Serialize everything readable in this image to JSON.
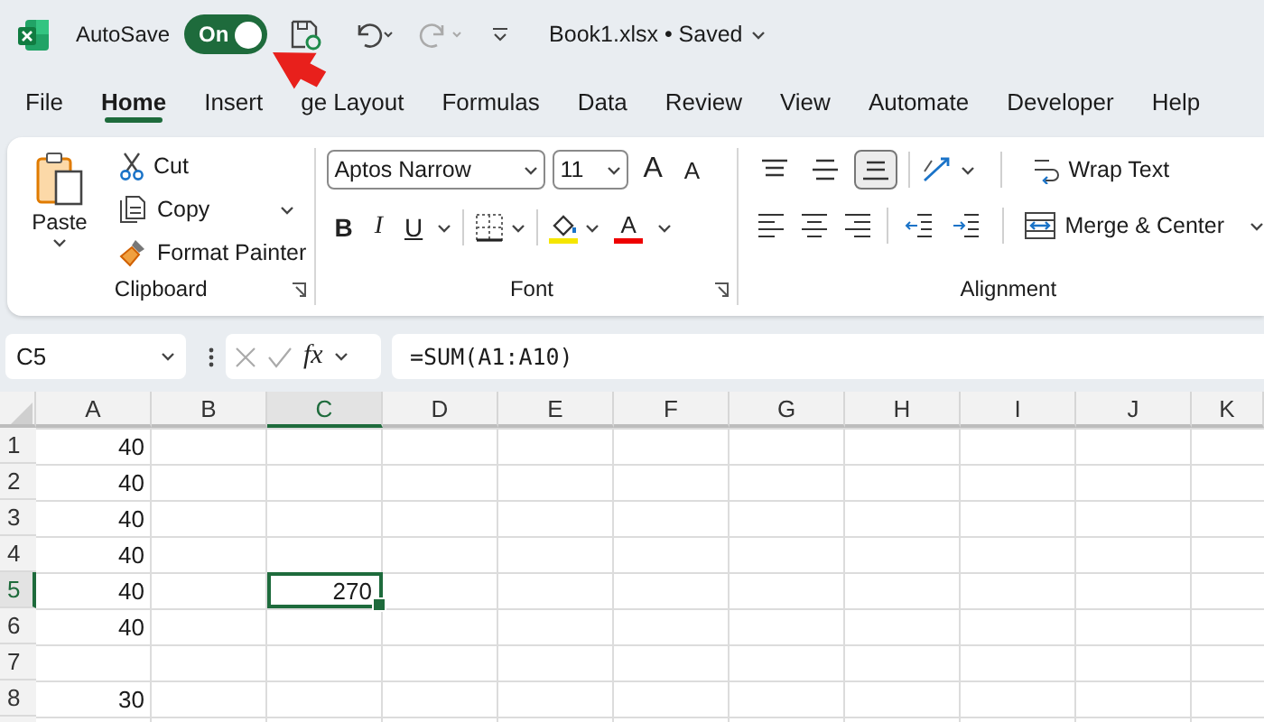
{
  "title_bar": {
    "autosave_label": "AutoSave",
    "autosave_toggle": {
      "label": "On",
      "on": true
    },
    "document_title": "Book1.xlsx • Saved"
  },
  "ribbon_tabs": [
    {
      "label": "File",
      "selected": false
    },
    {
      "label": "Home",
      "selected": true
    },
    {
      "label": "Insert",
      "selected": false
    },
    {
      "label": "ge Layout",
      "selected": false
    },
    {
      "label": "Formulas",
      "selected": false
    },
    {
      "label": "Data",
      "selected": false
    },
    {
      "label": "Review",
      "selected": false
    },
    {
      "label": "View",
      "selected": false
    },
    {
      "label": "Automate",
      "selected": false
    },
    {
      "label": "Developer",
      "selected": false
    },
    {
      "label": "Help",
      "selected": false
    }
  ],
  "clipboard": {
    "paste": "Paste",
    "cut": "Cut",
    "copy": "Copy",
    "format_painter": "Format Painter",
    "group_label": "Clipboard"
  },
  "font": {
    "font_name": "Aptos Narrow",
    "font_size": "11",
    "grow_glyph": "A",
    "shrink_glyph": "A",
    "bold_glyph": "B",
    "italic_glyph": "I",
    "underline_glyph": "U",
    "font_color_glyph": "A",
    "group_label": "Font"
  },
  "alignment": {
    "vertical_align": [
      {
        "selected": false
      },
      {
        "selected": false
      },
      {
        "selected": true
      }
    ],
    "wrap_text": "Wrap Text",
    "merge_center": "Merge & Center",
    "group_label": "Alignment"
  },
  "formula_bar": {
    "name_box": "C5",
    "function_label": "fx",
    "formula": "=SUM(A1:A10)"
  },
  "sheet": {
    "columns": [
      {
        "label": "A",
        "selected": false
      },
      {
        "label": "B",
        "selected": false
      },
      {
        "label": "C",
        "selected": true
      },
      {
        "label": "D",
        "selected": false
      },
      {
        "label": "E",
        "selected": false
      },
      {
        "label": "F",
        "selected": false
      },
      {
        "label": "G",
        "selected": false
      },
      {
        "label": "H",
        "selected": false
      },
      {
        "label": "I",
        "selected": false
      },
      {
        "label": "J",
        "selected": false
      },
      {
        "label": "K",
        "selected": false
      }
    ],
    "rows": [
      {
        "label": "1",
        "selected": false,
        "cells": [
          {
            "value": "40",
            "selected": false
          }
        ]
      },
      {
        "label": "2",
        "selected": false,
        "cells": [
          {
            "value": "40",
            "selected": false
          }
        ]
      },
      {
        "label": "3",
        "selected": false,
        "cells": [
          {
            "value": "40",
            "selected": false
          }
        ]
      },
      {
        "label": "4",
        "selected": false,
        "cells": [
          {
            "value": "40",
            "selected": false
          }
        ]
      },
      {
        "label": "5",
        "selected": true,
        "cells": [
          {
            "value": "40",
            "selected": false
          },
          null,
          {
            "value": "270",
            "selected": true
          }
        ]
      },
      {
        "label": "6",
        "selected": false,
        "cells": [
          {
            "value": "40",
            "selected": false
          }
        ]
      },
      {
        "label": "7",
        "selected": false,
        "cells": []
      },
      {
        "label": "8",
        "selected": false,
        "cells": [
          {
            "value": "30",
            "selected": false
          }
        ]
      }
    ]
  }
}
